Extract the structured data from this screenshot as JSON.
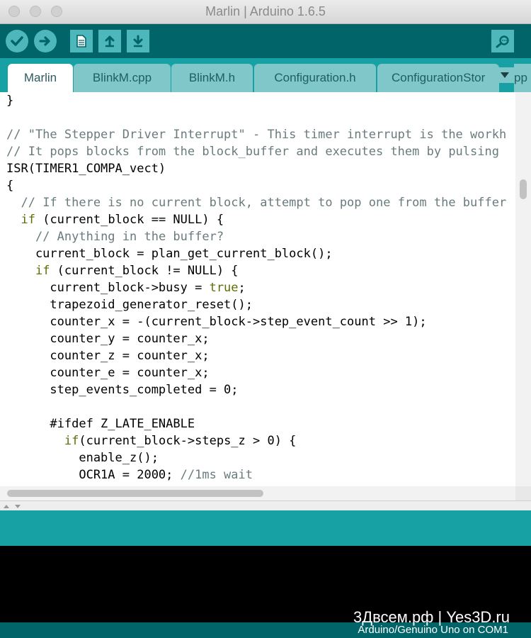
{
  "window": {
    "title": "Marlin | Arduino 1.6.5"
  },
  "toolbar": {
    "verify_icon": "checkmark-icon",
    "upload_icon": "arrow-right-icon",
    "new_icon": "new-file-icon",
    "open_icon": "arrow-up-icon",
    "save_icon": "arrow-down-icon",
    "serial_monitor_icon": "magnifier-icon"
  },
  "tabs": [
    {
      "label": "Marlin"
    },
    {
      "label": "BlinkM.cpp"
    },
    {
      "label": "BlinkM.h"
    },
    {
      "label": "Configuration.h"
    },
    {
      "label": "ConfigurationStor"
    },
    {
      "label": "pp"
    }
  ],
  "code": {
    "lines": [
      "}",
      "",
      "// \"The Stepper Driver Interrupt\" - This timer interrupt is the workh",
      "// It pops blocks from the block_buffer and executes them by pulsing",
      "ISR(TIMER1_COMPA_vect)",
      "{",
      "  // If there is no current block, attempt to pop one from the buffer",
      "  if (current_block == NULL) {",
      "    // Anything in the buffer?",
      "    current_block = plan_get_current_block();",
      "    if (current_block != NULL) {",
      "      current_block->busy = true;",
      "      trapezoid_generator_reset();",
      "      counter_x = -(current_block->step_event_count >> 1);",
      "      counter_y = counter_x;",
      "      counter_z = counter_x;",
      "      counter_e = counter_x;",
      "      step_events_completed = 0;",
      "",
      "      #ifdef Z_LATE_ENABLE",
      "        if(current_block->steps_z > 0) {",
      "          enable_z();",
      "          OCR1A = 2000; //1ms wait"
    ]
  },
  "status_bar": {
    "board": "Arduino/Genuino Uno on COM1"
  },
  "watermark": {
    "text": "3Двсем.рф | Yes3D.ru"
  },
  "colors": {
    "toolbar": "#006468",
    "tabs_bar": "#17a1a5",
    "button": "#4db7bb",
    "tab_inactive": "#7fc7c9",
    "keyword": "#5e6d03",
    "comment": "#6a7b7d"
  }
}
